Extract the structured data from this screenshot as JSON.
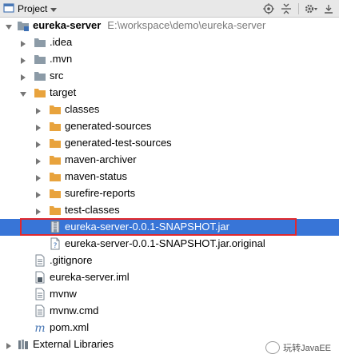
{
  "toolbar": {
    "title": "Project",
    "icons": [
      "project-view-icon",
      "dropdown-arrow-icon",
      "locate-icon",
      "collapse-all-icon",
      "settings-icon",
      "hide-icon"
    ]
  },
  "tree": {
    "root": {
      "label": "eureka-server",
      "path": "E:\\workspace\\demo\\eureka-server"
    },
    "items": [
      {
        "label": ".idea"
      },
      {
        "label": ".mvn"
      },
      {
        "label": "src"
      },
      {
        "label": "target"
      },
      {
        "label": "classes"
      },
      {
        "label": "generated-sources"
      },
      {
        "label": "generated-test-sources"
      },
      {
        "label": "maven-archiver"
      },
      {
        "label": "maven-status"
      },
      {
        "label": "surefire-reports"
      },
      {
        "label": "test-classes"
      },
      {
        "label": "eureka-server-0.0.1-SNAPSHOT.jar"
      },
      {
        "label": "eureka-server-0.0.1-SNAPSHOT.jar.original"
      },
      {
        "label": ".gitignore"
      },
      {
        "label": "eureka-server.iml"
      },
      {
        "label": "mvnw"
      },
      {
        "label": "mvnw.cmd"
      },
      {
        "label": "pom.xml"
      },
      {
        "label": "External Libraries"
      }
    ]
  },
  "colors": {
    "selection": "#3875d7",
    "highlight_border": "#e0282e",
    "folder": "#8c9ba7",
    "orange_folder": "#e8a33d"
  },
  "watermark": {
    "text": "玩转JavaEE"
  }
}
